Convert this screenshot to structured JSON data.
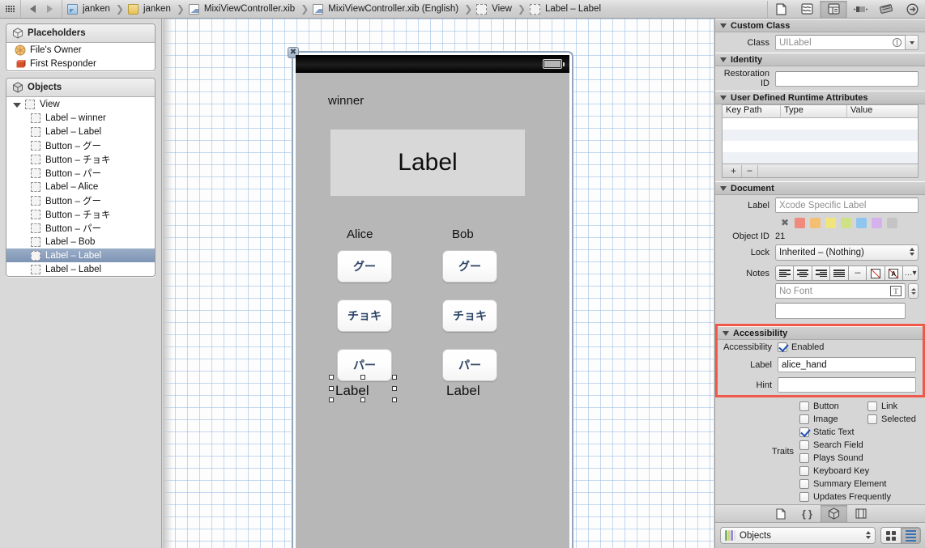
{
  "topbar": {
    "grid_icon": "grid-icon",
    "back_icon": "back-arrow-icon",
    "forward_icon": "forward-arrow-icon",
    "breadcrumbs": [
      {
        "label": "janken",
        "icon": "xcode-project-icon"
      },
      {
        "label": "janken",
        "icon": "folder-icon"
      },
      {
        "label": "MixiViewController.xib",
        "icon": "xib-file-icon"
      },
      {
        "label": "MixiViewController.xib (English)",
        "icon": "xib-file-icon"
      },
      {
        "label": "View",
        "icon": "view-object-icon"
      },
      {
        "label": "Label – Label",
        "icon": "label-object-icon"
      }
    ],
    "right_buttons": [
      {
        "name": "standard-editor-button",
        "glyph": "D",
        "active": false
      },
      {
        "name": "assistant-editor-button",
        "glyph": "≈",
        "active": false
      },
      {
        "name": "version-editor-button",
        "glyph": "≡",
        "active": true
      },
      {
        "name": "hide-navigator-button",
        "glyph": "◗",
        "active": false
      },
      {
        "name": "hide-debug-button",
        "glyph": "▤",
        "active": false
      },
      {
        "name": "hide-utilities-button",
        "glyph": "→",
        "active": false
      }
    ]
  },
  "navigator": {
    "placeholders": {
      "title": "Placeholders",
      "icon": "cube-icon",
      "items": [
        {
          "label": "File's Owner",
          "icon": "files-owner-icon"
        },
        {
          "label": "First Responder",
          "icon": "first-responder-icon"
        }
      ]
    },
    "objects": {
      "title": "Objects",
      "icon": "cube-icon",
      "root": {
        "label": "View",
        "icon": "view-icon",
        "expanded": true
      },
      "items": [
        {
          "label": "Label – winner",
          "selected": false
        },
        {
          "label": "Label – Label",
          "selected": false
        },
        {
          "label": "Button – グー",
          "selected": false
        },
        {
          "label": "Button – チョキ",
          "selected": false
        },
        {
          "label": "Button – パー",
          "selected": false
        },
        {
          "label": "Label – Alice",
          "selected": false
        },
        {
          "label": "Button – グー",
          "selected": false
        },
        {
          "label": "Button – チョキ",
          "selected": false
        },
        {
          "label": "Button – パー",
          "selected": false
        },
        {
          "label": "Label – Bob",
          "selected": false
        },
        {
          "label": "Label – Label",
          "selected": true
        },
        {
          "label": "Label – Label",
          "selected": false
        }
      ]
    }
  },
  "canvas": {
    "device": {
      "close_glyph": "✖",
      "status_bar": {
        "battery_icon": "battery-icon"
      },
      "winner_label": "winner",
      "big_label": "Label",
      "players": [
        {
          "name": "Alice",
          "buttons": [
            "グー",
            "チョキ",
            "パー"
          ],
          "result_label": "Label",
          "selected": true
        },
        {
          "name": "Bob",
          "buttons": [
            "グー",
            "チョキ",
            "パー"
          ],
          "result_label": "Label",
          "selected": false
        }
      ]
    }
  },
  "inspector": {
    "custom_class": {
      "title": "Custom Class",
      "class_label": "Class",
      "class_value": "UILabel"
    },
    "identity": {
      "title": "Identity",
      "restoration_label": "Restoration ID",
      "restoration_value": "",
      "restoration_placeholder": ""
    },
    "udra": {
      "title": "User Defined Runtime Attributes",
      "columns": [
        "Key Path",
        "Type",
        "Value"
      ],
      "rows": [],
      "add_glyph": "+",
      "remove_glyph": "−"
    },
    "document": {
      "title": "Document",
      "label_label": "Label",
      "label_placeholder": "Xcode Specific Label",
      "label_value": "",
      "swatch_clear": "✖",
      "swatches": [
        "#f08a7d",
        "#f4bf72",
        "#f2e47c",
        "#cfe184",
        "#8ec6f0",
        "#d5b2ee",
        "#c4c4c4"
      ],
      "object_id_label": "Object ID",
      "object_id_value": "21",
      "lock_label": "Lock",
      "lock_value": "Inherited – (Nothing)",
      "notes_label": "Notes",
      "notes_toolbar": [
        "align-left-icon",
        "align-center-icon",
        "align-right-icon",
        "align-justify-icon",
        "list-icon",
        "color-icon",
        "text-color-icon",
        "more-icon"
      ],
      "font_placeholder": "No Font",
      "notes_value": ""
    },
    "accessibility": {
      "title": "Accessibility",
      "highlighted": true,
      "highlight_color": "#f0594a",
      "enabled_label": "Accessibility",
      "enabled_checkbox_label": "Enabled",
      "enabled_checked": true,
      "label_label": "Label",
      "label_value": "alice_hand",
      "hint_label": "Hint",
      "hint_value": "",
      "traits_label": "Traits",
      "traits": [
        {
          "label": "Button",
          "checked": false
        },
        {
          "label": "Link",
          "checked": false
        },
        {
          "label": "Image",
          "checked": false
        },
        {
          "label": "Selected",
          "checked": false
        },
        {
          "label": "Static Text",
          "checked": true
        },
        {
          "label": "Search Field",
          "checked": false
        },
        {
          "label": "Plays Sound",
          "checked": false
        },
        {
          "label": "Keyboard Key",
          "checked": false
        },
        {
          "label": "Summary Element",
          "checked": false
        },
        {
          "label": "Updates Frequently",
          "checked": false
        }
      ]
    },
    "footer_tabs": [
      {
        "name": "file-template-library-button",
        "glyph": "D",
        "active": false
      },
      {
        "name": "code-snippet-library-button",
        "glyph": "{ }",
        "active": false
      },
      {
        "name": "object-library-button",
        "glyph": "⬡",
        "active": true
      },
      {
        "name": "media-library-button",
        "glyph": "▤",
        "active": false
      }
    ],
    "library": {
      "selected": "Objects",
      "icon": "library-icon",
      "view_mode_grid": "grid-view-icon",
      "view_mode_list": "list-view-icon",
      "list_active": true
    }
  }
}
